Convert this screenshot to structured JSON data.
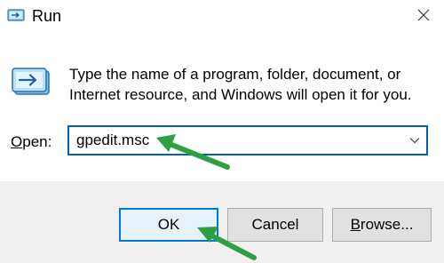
{
  "title_bar": {
    "title": "Run",
    "icon": "run-app-icon",
    "close_icon": "close-icon"
  },
  "body": {
    "description": "Type the name of a program, folder, document, or Internet resource, and Windows will open it for you.",
    "logo_icon": "run-dialog-icon"
  },
  "open_field": {
    "label_accel": "O",
    "label_rest": "pen:",
    "value": "gpedit.msc",
    "dropdown_icon": "chevron-down-icon"
  },
  "buttons": {
    "ok": "OK",
    "cancel": "Cancel",
    "browse_accel": "B",
    "browse_rest": "rowse..."
  },
  "annotations": {
    "arrow_color": "#2ea043",
    "arrows": [
      "pointer-to-input",
      "pointer-to-ok"
    ]
  },
  "colors": {
    "focus_border": "#0063b1",
    "ok_border": "#0078d7",
    "footer_bg": "#f0f0f0"
  }
}
